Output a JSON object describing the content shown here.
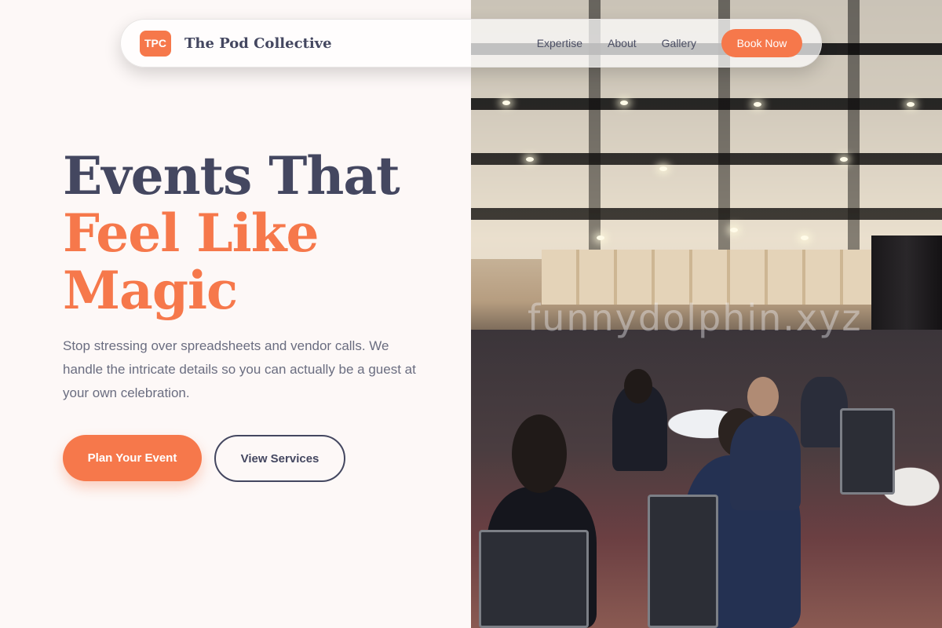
{
  "navbar": {
    "logo_initials": "TPC",
    "brand_name": "The Pod Collective",
    "links": [
      "Expertise",
      "About",
      "Gallery"
    ],
    "cta_label": "Book Now"
  },
  "hero": {
    "headline_line1": "Events That",
    "headline_line2": "Feel Like",
    "headline_line3": "Magic",
    "subcopy": "Stop stressing over spreadsheets and vendor calls. We handle the intricate details so you can actually be a guest at your own celebration.",
    "primary_button": "Plan Your Event",
    "secondary_button": "View Services"
  },
  "photo": {
    "watermark": "funnydolphin.xyz"
  },
  "colors": {
    "accent": "#f6784b",
    "navy": "#444760",
    "background": "#fdf8f7"
  }
}
